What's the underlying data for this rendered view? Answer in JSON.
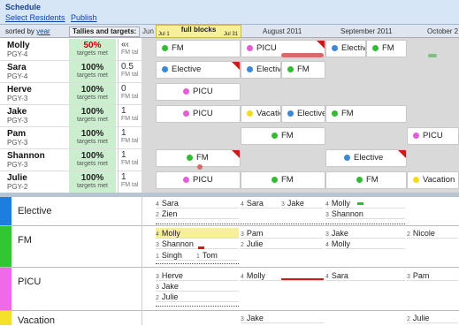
{
  "app": {
    "title": "Schedule",
    "links": [
      "Select Residents",
      "Publish"
    ]
  },
  "header": {
    "sorted_by_label": "sorted by",
    "sorted_by_value": "year",
    "tallies_label": "Tallies and targets:",
    "jun_label": "Jun",
    "full_blocks": "full blocks",
    "block_start": "Jul 1",
    "block_end": "Jul 31",
    "months": [
      "August 2011",
      "September 2011",
      "October 2"
    ]
  },
  "residents": [
    {
      "name": "Molly",
      "pgy": "PGY-4",
      "pct": "50%",
      "pct_color": "#cc0000",
      "sub": "targets met",
      "t2": "«‹",
      "t2s": "FM tal"
    },
    {
      "name": "Sara",
      "pgy": "PGY-4",
      "pct": "100%",
      "pct_color": "#222",
      "sub": "targets met",
      "t2": "0.5",
      "t2s": "FM tal"
    },
    {
      "name": "Herve",
      "pgy": "PGY-3",
      "pct": "100%",
      "pct_color": "#222",
      "sub": "targets met",
      "t2": "0",
      "t2s": "FM tal"
    },
    {
      "name": "Jake",
      "pgy": "PGY-3",
      "pct": "100%",
      "pct_color": "#222",
      "sub": "targets met",
      "t2": "1",
      "t2s": "FM tal"
    },
    {
      "name": "Pam",
      "pgy": "PGY-3",
      "pct": "100%",
      "pct_color": "#222",
      "sub": "targets met",
      "t2": "1",
      "t2s": "FM tal"
    },
    {
      "name": "Shannon",
      "pgy": "PGY-3",
      "pct": "100%",
      "pct_color": "#222",
      "sub": "targets met",
      "t2": "1",
      "t2s": "FM tal"
    },
    {
      "name": "Julie",
      "pgy": "PGY-2",
      "pct": "100%",
      "pct_color": "#222",
      "sub": "targets met",
      "t2": "1",
      "t2s": "FM tal"
    }
  ],
  "rotations": {
    "FM": "#33bb33",
    "PICU": "#e05fd4",
    "Elective": "#3a88d6",
    "Vacation": "#f0dc1e"
  },
  "blocks": [
    [
      "FM",
      "PICU",
      "Elective FM"
    ],
    [
      "Elective",
      "Elective",
      "FM"
    ],
    [
      "PICU"
    ],
    [
      "PICU",
      "Vacation",
      "Elective",
      "FM"
    ],
    [
      "FM",
      "PICU"
    ],
    [
      "FM",
      "Elective"
    ],
    [
      "PICU",
      "FM",
      "FM",
      "Vacation"
    ]
  ],
  "block_labels": {
    "fm": "FM",
    "picu": "PICU",
    "elective": "Elective",
    "vacation": "Vacation"
  },
  "categories": [
    {
      "name": "Elective",
      "color": "#1e7ee0"
    },
    {
      "name": "FM",
      "color": "#33c633"
    },
    {
      "name": "PICU",
      "color": "#f06ae8"
    },
    {
      "name": "Vacation",
      "color": "#f5e02a"
    }
  ],
  "assign": {
    "e1": [
      "4",
      "Sara"
    ],
    "e2": [
      "2",
      "Zien"
    ],
    "e3": [
      "4",
      "Sara"
    ],
    "e4": [
      "3",
      "Jake"
    ],
    "e5": [
      "4",
      "Molly"
    ],
    "e6": [
      "3",
      "Shannon"
    ],
    "f1": [
      "4",
      "Molly"
    ],
    "f2": [
      "3",
      "Shannon"
    ],
    "f3": [
      "1",
      "Singh"
    ],
    "f4": [
      "1",
      "Tom"
    ],
    "f5": [
      "3",
      "Pam"
    ],
    "f6": [
      "2",
      "Julie"
    ],
    "f7": [
      "3",
      "Jake"
    ],
    "f8": [
      "4",
      "Molly"
    ],
    "f9": [
      "2",
      "Nicole"
    ],
    "p1": [
      "3",
      "Herve"
    ],
    "p2": [
      "3",
      "Jake"
    ],
    "p3": [
      "2",
      "Julie"
    ],
    "p4": [
      "4",
      "Molly"
    ],
    "p5": [
      "4",
      "Sara"
    ],
    "p6": [
      "3",
      "Pam"
    ],
    "v1": [
      "3",
      "Jake"
    ],
    "v2": [
      "2",
      "Julie"
    ]
  }
}
